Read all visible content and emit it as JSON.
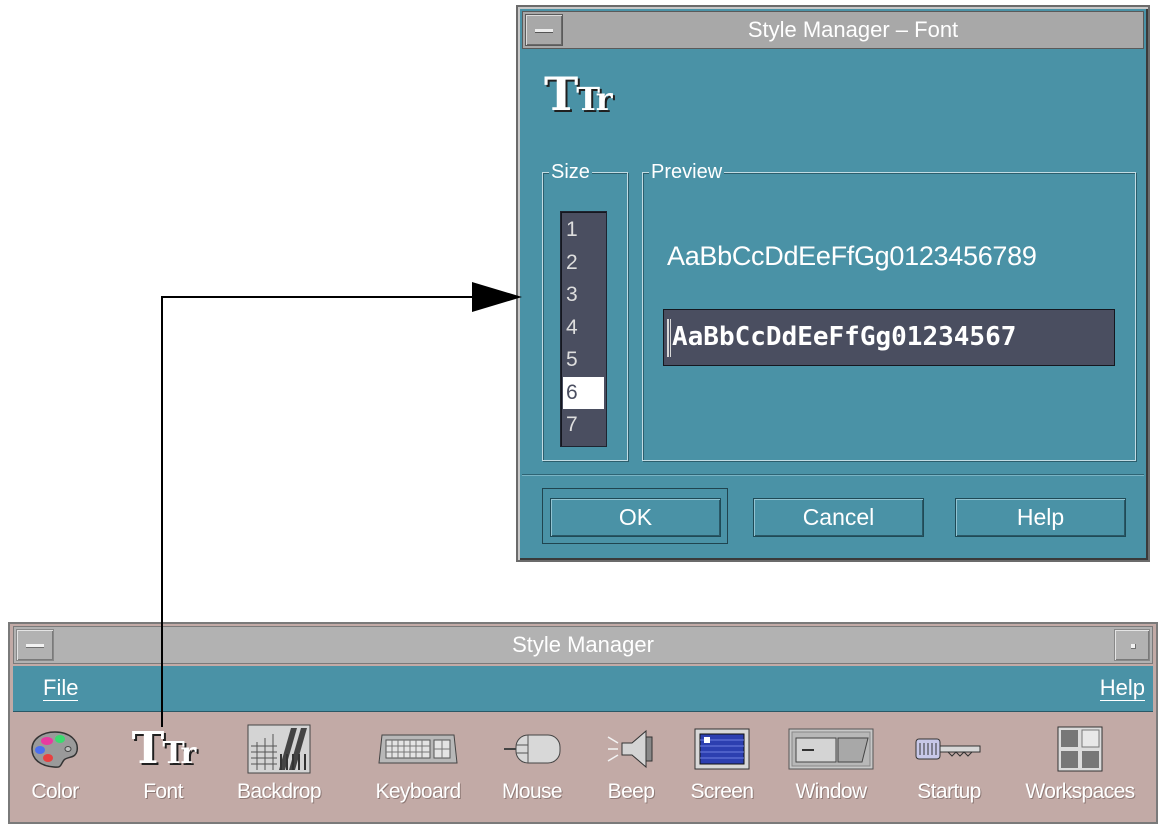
{
  "font_dialog": {
    "title": "Style Manager – Font",
    "icon_text": {
      "big": "T",
      "small": "Tr"
    },
    "size_group_label": "Size",
    "sizes": [
      "1",
      "2",
      "3",
      "4",
      "5",
      "6",
      "7"
    ],
    "selected_size": "6",
    "preview_group_label": "Preview",
    "preview_sample": "AaBbCcDdEeFfGg0123456789",
    "preview_field_value": "AaBbCcDdEeFfGg01234567",
    "buttons": {
      "ok": "OK",
      "cancel": "Cancel",
      "help": "Help"
    }
  },
  "main_window": {
    "title": "Style Manager",
    "menu": {
      "file": "File",
      "help": "Help"
    },
    "icons": [
      {
        "label": "Color",
        "icon": "palette-icon"
      },
      {
        "label": "Font",
        "icon": "font-icon",
        "glyph_big": "T",
        "glyph_small": "Tr"
      },
      {
        "label": "Backdrop",
        "icon": "backdrop-icon"
      },
      {
        "label": "Keyboard",
        "icon": "keyboard-icon"
      },
      {
        "label": "Mouse",
        "icon": "mouse-icon"
      },
      {
        "label": "Beep",
        "icon": "speaker-icon"
      },
      {
        "label": "Screen",
        "icon": "screen-icon"
      },
      {
        "label": "Window",
        "icon": "window-icon"
      },
      {
        "label": "Startup",
        "icon": "key-icon"
      },
      {
        "label": "Workspaces",
        "icon": "workspaces-icon"
      }
    ]
  },
  "colors": {
    "panel": "#4a92a6",
    "list_bg": "#4a4e60",
    "main_bg": "#c2aaa6",
    "titlebar": "#a8a8a8"
  }
}
